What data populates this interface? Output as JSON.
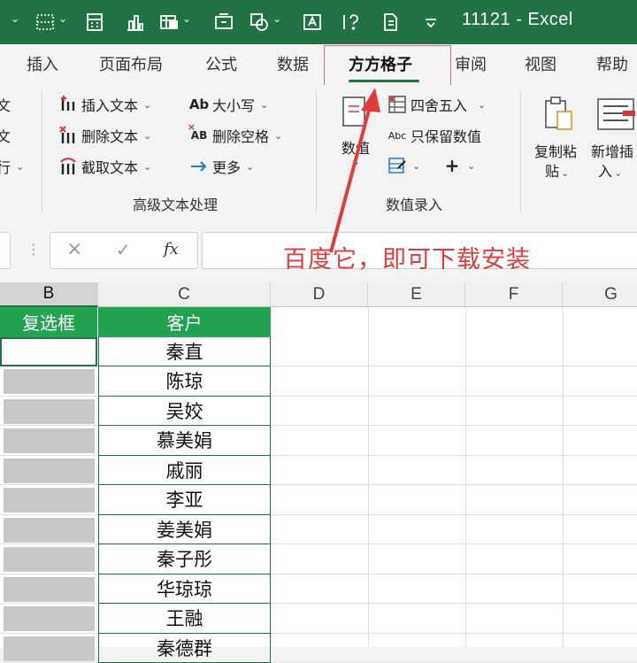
{
  "window": {
    "title": "11121  -  Excel"
  },
  "tabs": [
    {
      "label": "插入"
    },
    {
      "label": "页面布局"
    },
    {
      "label": "公式"
    },
    {
      "label": "数据"
    },
    {
      "label": "方方格子"
    },
    {
      "label": "审阅"
    },
    {
      "label": "视图"
    },
    {
      "label": "帮助"
    }
  ],
  "ribbon": {
    "left_cut": [
      "文",
      "文",
      "行"
    ],
    "text_group": {
      "items": [
        "插入文本",
        "删除文本",
        "截取文本",
        "大小写",
        "删除空格",
        "更多"
      ],
      "icon_labels": {
        "case": "Ab",
        "trim": "AB"
      },
      "label": "高级文本处理"
    },
    "numeric_group": {
      "numeric_label": "数值",
      "items": [
        "四舍五入",
        "只保留数值"
      ],
      "icon_labels": {
        "keep_numeric": "Abc"
      },
      "label": "数值录入"
    },
    "copy_paste": {
      "line1": "复制粘",
      "line2": "贴"
    },
    "new_insert": {
      "line1": "新增插",
      "line2": "入"
    }
  },
  "formula_bar": {
    "fx": "fx"
  },
  "annotation": {
    "text": "百度它，即可下载安装"
  },
  "grid": {
    "columns": [
      "B",
      "C",
      "D",
      "E",
      "F",
      "G"
    ],
    "header_row": {
      "b": "复选框",
      "c": "客户"
    },
    "customers": [
      "秦直",
      "陈琼",
      "吴姣",
      "慕美娟",
      "戚丽",
      "李亚",
      "姜美娟",
      "秦子彤",
      "华琼琼",
      "王融",
      "秦德群"
    ]
  },
  "colors": {
    "excel_green": "#217346",
    "header_green": "#21a34f",
    "annotation_red": "#e03c3c"
  }
}
